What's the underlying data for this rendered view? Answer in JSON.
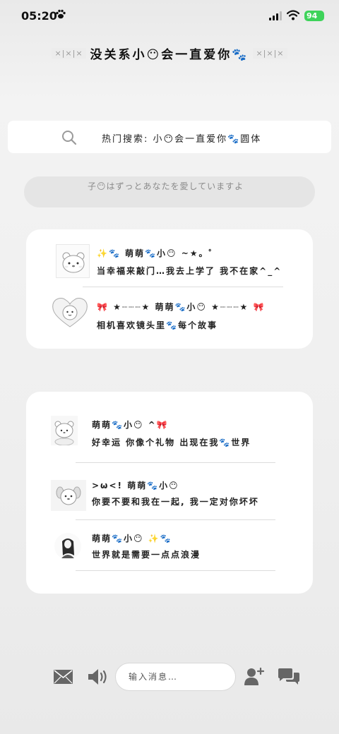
{
  "status_bar": {
    "time": "05:20",
    "battery": "94"
  },
  "header": {
    "deco_left": "×|×|×",
    "title": "没关系小😶会一直爱你🐾",
    "deco_right": "×|×|×"
  },
  "search": {
    "text": "热门搜索: 小😶会一直爱你🐾圆体"
  },
  "quote": {
    "text": "子😶はずっとあなたを愛していますよ"
  },
  "card1": {
    "items": [
      {
        "name": "✨🐾 萌萌🐾小😶 ~★。゜",
        "message": "当幸福来敲门…我去上学了 我不在家^_^"
      },
      {
        "name": "🎀 ★┈┈┈★ 萌萌🐾小😶 ★┈┈┈★ 🎀",
        "message": "相机喜欢镜头里🐾每个故事"
      }
    ]
  },
  "card2": {
    "items": [
      {
        "name": "萌萌🐾小😶 ^🎀",
        "message": "好幸运 你像个礼物 出现在我🐾世界"
      },
      {
        "name": ">ω<! 萌萌🐾小😶",
        "message": "你要不要和我在一起, 我一定对你坏坏"
      },
      {
        "name": "萌萌🐾小😶 ✨🐾",
        "message": "世界就是需要一点点浪漫"
      }
    ]
  },
  "bottom": {
    "input_placeholder": "输入消息…"
  },
  "icons": {
    "status": [
      "paw-icon",
      "signal-icon",
      "wifi-icon"
    ],
    "search": "search-icon",
    "bottom": [
      "mail-icon",
      "speaker-icon",
      "add-user-icon",
      "chat-icon"
    ]
  },
  "colors": {
    "battery": "#3ed35a",
    "card": "#ffffff",
    "background": "#efefef"
  }
}
